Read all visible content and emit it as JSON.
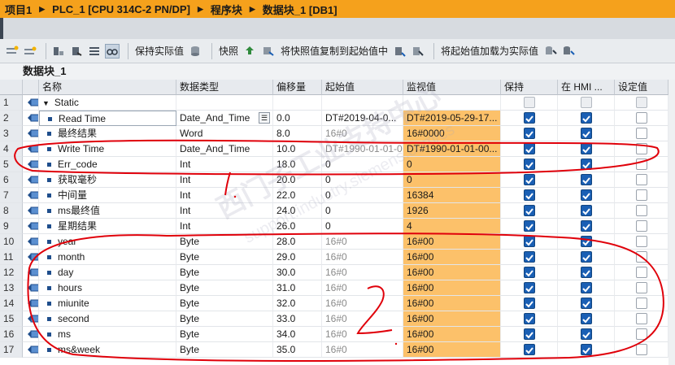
{
  "breadcrumb": [
    "项目1",
    "PLC_1 [CPU 314C-2 PN/DP]",
    "程序块",
    "数据块_1 [DB1]"
  ],
  "toolbar": {
    "keep_actual": "保持实际值",
    "snapshot": "快照",
    "copy_snapshot": "将快照值复制到起始值中",
    "load_start": "将起始值加载为实际值"
  },
  "block_title": "数据块_1",
  "columns": [
    "名称",
    "数据类型",
    "偏移量",
    "起始值",
    "监视值",
    "保持",
    "在 HMI ...",
    "设定值"
  ],
  "rows": [
    {
      "num": "1",
      "name": "Static",
      "type": "",
      "offset": "",
      "start": "",
      "monitor": "",
      "retain": "none",
      "hmi": "none",
      "setp": "none",
      "section": true
    },
    {
      "num": "2",
      "name": "Read Time",
      "type": "Date_And_Time",
      "offset": "0.0",
      "start": "DT#2019-04-0...",
      "monitor": "DT#2019-05-29-17...",
      "retain": "on",
      "hmi": "on",
      "setp": "off",
      "picker": true
    },
    {
      "num": "3",
      "name": "最终结果",
      "type": "Word",
      "offset": "8.0",
      "start": "16#0",
      "monitor": "16#0000",
      "retain": "on",
      "hmi": "on",
      "setp": "off"
    },
    {
      "num": "4",
      "name": "Write Time",
      "type": "Date_And_Time",
      "offset": "10.0",
      "start": "DT#1990-01-01-0...",
      "monitor": "DT#1990-01-01-00...",
      "retain": "on",
      "hmi": "on",
      "setp": "off"
    },
    {
      "num": "5",
      "name": "Err_code",
      "type": "Int",
      "offset": "18.0",
      "start": "0",
      "monitor": "0",
      "retain": "on",
      "hmi": "on",
      "setp": "off"
    },
    {
      "num": "6",
      "name": "获取毫秒",
      "type": "Int",
      "offset": "20.0",
      "start": "0",
      "monitor": "0",
      "retain": "on",
      "hmi": "on",
      "setp": "off"
    },
    {
      "num": "7",
      "name": "中间量",
      "type": "Int",
      "offset": "22.0",
      "start": "0",
      "monitor": "16384",
      "retain": "on",
      "hmi": "on",
      "setp": "off"
    },
    {
      "num": "8",
      "name": "ms最终值",
      "type": "Int",
      "offset": "24.0",
      "start": "0",
      "monitor": "1926",
      "retain": "on",
      "hmi": "on",
      "setp": "off"
    },
    {
      "num": "9",
      "name": "星期结果",
      "type": "Int",
      "offset": "26.0",
      "start": "0",
      "monitor": "4",
      "retain": "on",
      "hmi": "on",
      "setp": "off"
    },
    {
      "num": "10",
      "name": "year",
      "type": "Byte",
      "offset": "28.0",
      "start": "16#0",
      "monitor": "16#00",
      "retain": "on",
      "hmi": "on",
      "setp": "off"
    },
    {
      "num": "11",
      "name": "month",
      "type": "Byte",
      "offset": "29.0",
      "start": "16#0",
      "monitor": "16#00",
      "retain": "on",
      "hmi": "on",
      "setp": "off"
    },
    {
      "num": "12",
      "name": "day",
      "type": "Byte",
      "offset": "30.0",
      "start": "16#0",
      "monitor": "16#00",
      "retain": "on",
      "hmi": "on",
      "setp": "off"
    },
    {
      "num": "13",
      "name": "hours",
      "type": "Byte",
      "offset": "31.0",
      "start": "16#0",
      "monitor": "16#00",
      "retain": "on",
      "hmi": "on",
      "setp": "off"
    },
    {
      "num": "14",
      "name": "miunite",
      "type": "Byte",
      "offset": "32.0",
      "start": "16#0",
      "monitor": "16#00",
      "retain": "on",
      "hmi": "on",
      "setp": "off"
    },
    {
      "num": "15",
      "name": "second",
      "type": "Byte",
      "offset": "33.0",
      "start": "16#0",
      "monitor": "16#00",
      "retain": "on",
      "hmi": "on",
      "setp": "off"
    },
    {
      "num": "16",
      "name": "ms",
      "type": "Byte",
      "offset": "34.0",
      "start": "16#0",
      "monitor": "16#00",
      "retain": "on",
      "hmi": "on",
      "setp": "off"
    },
    {
      "num": "17",
      "name": "ms&week",
      "type": "Byte",
      "offset": "35.0",
      "start": "16#0",
      "monitor": "16#00",
      "retain": "on",
      "hmi": "on",
      "setp": "off"
    }
  ],
  "watermark": {
    "line1": "西门子工业支持中心",
    "line2": "support.industry.siemens.com/cs"
  },
  "annotations": {
    "label_1": "1",
    "label_2": "2"
  },
  "colors": {
    "title_bar": "#f5a11c",
    "monitor_cell": "#fcc16a",
    "checkbox_on": "#1a5fb4",
    "ink": "#e0000a"
  }
}
